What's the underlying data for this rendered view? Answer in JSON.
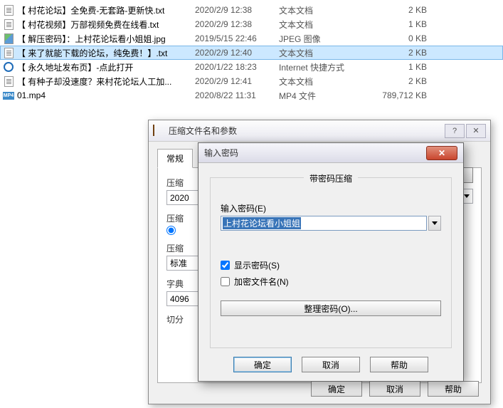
{
  "files": [
    {
      "name": "【 村花论坛】全免费-无套路-更新快.txt",
      "date": "2020/2/9 12:38",
      "type": "文本文档",
      "size": "2 KB",
      "icon": "txt"
    },
    {
      "name": "【 村花视频】万部视频免费在线看.txt",
      "date": "2020/2/9 12:38",
      "type": "文本文档",
      "size": "1 KB",
      "icon": "txt"
    },
    {
      "name": "【 解压密码】：上村花论坛看小姐姐.jpg",
      "date": "2019/5/15 22:46",
      "type": "JPEG 图像",
      "size": "0 KB",
      "icon": "jpg"
    },
    {
      "name": "【 来了就能下载的论坛，纯免费！】.txt",
      "date": "2020/2/9 12:40",
      "type": "文本文档",
      "size": "2 KB",
      "icon": "txt",
      "selected": true
    },
    {
      "name": "【 永久地址发布页】-点此打开",
      "date": "2020/1/22 18:23",
      "type": "Internet 快捷方式",
      "size": "1 KB",
      "icon": "ie"
    },
    {
      "name": "【 有种子却没速度？来村花论坛人工加...",
      "date": "2020/2/9 12:41",
      "type": "文本文档",
      "size": "2 KB",
      "icon": "txt"
    },
    {
      "name": "01.mp4",
      "date": "2020/8/22 11:31",
      "type": "MP4 文件",
      "size": "789,712 KB",
      "icon": "mp4"
    }
  ],
  "mainDialog": {
    "title": "压缩文件名和参数",
    "help": "?",
    "close": "✕",
    "tabs": {
      "general": "常规"
    },
    "archiveNameLabel": "压缩",
    "archiveName": "2020",
    "browse": "...",
    "compressLabel": "压缩",
    "methodLabel": "压缩",
    "stdLabel": "标准",
    "dictLabel": "字典",
    "dictVal": "4096",
    "splitLabel": "切分",
    "ok": "确定",
    "cancel": "取消",
    "helpBtn": "帮助"
  },
  "pwdDialog": {
    "title": "输入密码",
    "groupTitle": "带密码压缩",
    "passwordLabel": "输入密码(E)",
    "passwordValue": "上村花论坛看小姐姐",
    "showPassword": "显示密码(S)",
    "encryptNames": "加密文件名(N)",
    "organize": "整理密码(O)...",
    "ok": "确定",
    "cancel": "取消",
    "help": "帮助"
  }
}
